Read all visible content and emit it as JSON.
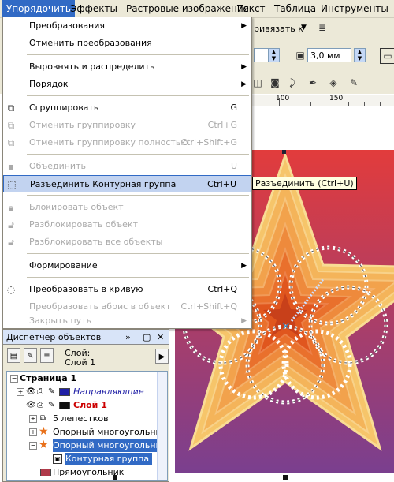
{
  "menubar": {
    "items": [
      "Упорядочить",
      "Эффекты",
      "Растровые изображения",
      "Текст",
      "Таблица",
      "Инструменты"
    ]
  },
  "toolbar": {
    "snap_label": "ривязать к",
    "outline_width": "3,0 мм"
  },
  "ruler": {
    "labels": [
      "100",
      "150"
    ]
  },
  "arrange_menu": {
    "items": [
      {
        "label": "Преобразования",
        "shortcut": "",
        "submenu": true,
        "disabled": false,
        "icon": "transform-icon"
      },
      {
        "label": "Отменить преобразования",
        "shortcut": "",
        "submenu": false,
        "disabled": false,
        "icon": ""
      },
      {
        "label": "Выровнять и распределить",
        "shortcut": "",
        "submenu": true,
        "disabled": false,
        "icon": ""
      },
      {
        "label": "Порядок",
        "shortcut": "",
        "submenu": true,
        "disabled": false,
        "icon": ""
      },
      {
        "label": "Сгруппировать",
        "shortcut": "G",
        "submenu": false,
        "disabled": false,
        "icon": "group-icon"
      },
      {
        "label": "Отменить группировку",
        "shortcut": "Ctrl+G",
        "submenu": false,
        "disabled": true,
        "icon": "ungroup-icon"
      },
      {
        "label": "Отменить группировку полностью",
        "shortcut": "Ctrl+Shift+G",
        "submenu": false,
        "disabled": true,
        "icon": "ungroup-all-icon"
      },
      {
        "label": "Объединить",
        "shortcut": "U",
        "submenu": false,
        "disabled": true,
        "icon": "combine-icon"
      },
      {
        "label": "Разъединить Контурная группа",
        "shortcut": "Ctrl+U",
        "submenu": false,
        "disabled": false,
        "icon": "break-apart-icon",
        "highlighted": true
      },
      {
        "label": "Блокировать объект",
        "shortcut": "",
        "submenu": false,
        "disabled": true,
        "icon": "lock-icon"
      },
      {
        "label": "Разблокировать объект",
        "shortcut": "",
        "submenu": false,
        "disabled": true,
        "icon": "unlock-icon"
      },
      {
        "label": "Разблокировать все объекты",
        "shortcut": "",
        "submenu": false,
        "disabled": true,
        "icon": "unlock-all-icon"
      },
      {
        "label": "Формирование",
        "shortcut": "",
        "submenu": true,
        "disabled": false,
        "icon": ""
      },
      {
        "label": "Преобразовать в кривую",
        "shortcut": "Ctrl+Q",
        "submenu": false,
        "disabled": false,
        "icon": "convert-to-curves-icon"
      },
      {
        "label": "Преобразовать абрис в объект",
        "shortcut": "Ctrl+Shift+Q",
        "submenu": false,
        "disabled": true,
        "icon": ""
      },
      {
        "label": "Закрыть путь",
        "shortcut": "",
        "submenu": true,
        "disabled": true,
        "icon": ""
      }
    ]
  },
  "tooltip": "Разъединить (Ctrl+U)",
  "object_manager": {
    "title": "Диспетчер объектов",
    "layer_label": "Слой:",
    "layer_value": "Слой 1",
    "tree": [
      {
        "label": "Страница 1",
        "level": 0,
        "bold": true
      },
      {
        "label": "Направляющие",
        "level": 1,
        "italic": true,
        "color": "#1f1fa6"
      },
      {
        "label": "Слой 1",
        "level": 1,
        "bold": true,
        "color": "#cc0000"
      },
      {
        "label": "5 лепестков",
        "level": 2
      },
      {
        "label": "Опорный многоугольник",
        "level": 2
      },
      {
        "label": "Опорный многоугольник",
        "level": 2,
        "selected": true
      },
      {
        "label": "Контурная группа",
        "level": 3,
        "selected": true
      },
      {
        "label": "Прямоугольник",
        "level": 2
      }
    ]
  },
  "colors": {
    "menu_highlight": "#c2d3f0",
    "selection": "#316ac5",
    "star_outer": "#f5b85a",
    "star_inner": "#e0501a",
    "bg_top": "#e03a3a",
    "bg_bottom": "#7a3f8f"
  }
}
